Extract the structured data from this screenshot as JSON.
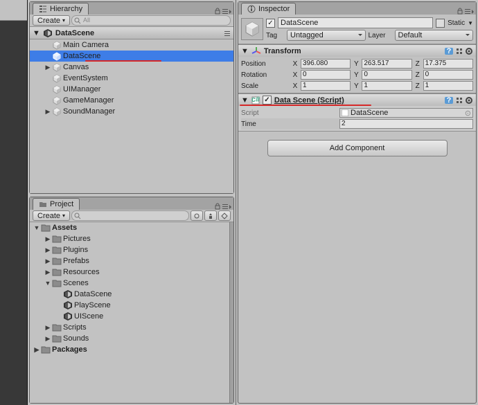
{
  "hierarchy": {
    "tab": "Hierarchy",
    "create": "Create",
    "searchPlaceholder": "All",
    "scene": "DataScene",
    "items": [
      {
        "label": "Main Camera",
        "indent": 1,
        "type": "go"
      },
      {
        "label": "DataScene",
        "indent": 1,
        "type": "go",
        "sel": true
      },
      {
        "label": "Canvas",
        "indent": 1,
        "type": "go",
        "fold": "▶"
      },
      {
        "label": "EventSystem",
        "indent": 1,
        "type": "go"
      },
      {
        "label": "UIManager",
        "indent": 1,
        "type": "go"
      },
      {
        "label": "GameManager",
        "indent": 1,
        "type": "go"
      },
      {
        "label": "SoundManager",
        "indent": 1,
        "type": "go",
        "fold": "▶"
      }
    ]
  },
  "project": {
    "tab": "Project",
    "create": "Create",
    "items": [
      {
        "label": "Assets",
        "indent": 0,
        "type": "folder",
        "fold": "▼",
        "bold": true
      },
      {
        "label": "Pictures",
        "indent": 1,
        "type": "folder",
        "fold": "▶"
      },
      {
        "label": "Plugins",
        "indent": 1,
        "type": "folder",
        "fold": "▶"
      },
      {
        "label": "Prefabs",
        "indent": 1,
        "type": "folder",
        "fold": "▶"
      },
      {
        "label": "Resources",
        "indent": 1,
        "type": "folder",
        "fold": "▶"
      },
      {
        "label": "Scenes",
        "indent": 1,
        "type": "folder",
        "fold": "▼"
      },
      {
        "label": "DataScene",
        "indent": 2,
        "type": "scene"
      },
      {
        "label": "PlayScene",
        "indent": 2,
        "type": "scene"
      },
      {
        "label": "UIScene",
        "indent": 2,
        "type": "scene"
      },
      {
        "label": "Scripts",
        "indent": 1,
        "type": "folder",
        "fold": "▶"
      },
      {
        "label": "Sounds",
        "indent": 1,
        "type": "folder",
        "fold": "▶"
      },
      {
        "label": "Packages",
        "indent": 0,
        "type": "folder",
        "fold": "▶",
        "bold": true
      }
    ]
  },
  "inspector": {
    "tab": "Inspector",
    "name": "DataScene",
    "staticLabel": "Static",
    "tagLabel": "Tag",
    "tag": "Untagged",
    "layerLabel": "Layer",
    "layer": "Default",
    "transform": {
      "title": "Transform",
      "position": {
        "label": "Position",
        "x": "396.080",
        "y": "263.517",
        "z": "17.375"
      },
      "rotation": {
        "label": "Rotation",
        "x": "0",
        "y": "0",
        "z": "0"
      },
      "scale": {
        "label": "Scale",
        "x": "1",
        "y": "1",
        "z": "1"
      }
    },
    "script": {
      "title": "Data Scene (Script)",
      "scriptLabel": "Script",
      "scriptName": "DataScene",
      "timeLabel": "Time",
      "time": "2"
    },
    "addComponent": "Add Component"
  }
}
